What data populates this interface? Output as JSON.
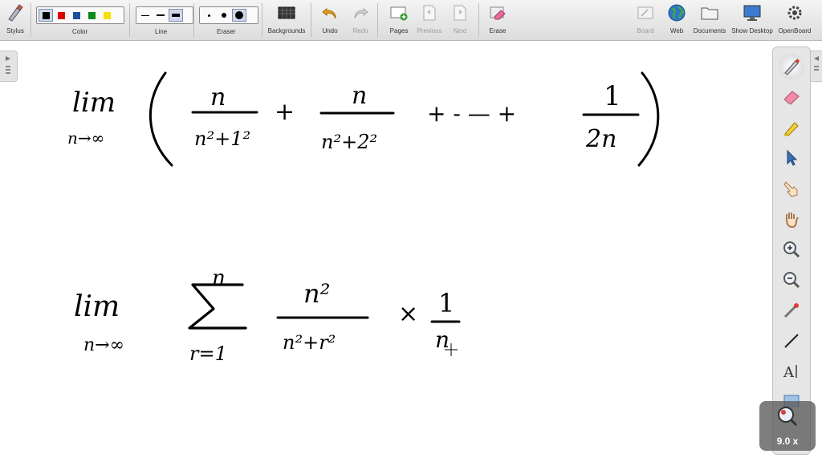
{
  "toolbar": {
    "stylus": "Stylus",
    "color": "Color",
    "line": "Line",
    "eraser": "Eraser",
    "backgrounds": "Backgrounds",
    "undo": "Undo",
    "redo": "Redo",
    "pages": "Pages",
    "previous": "Previous",
    "next": "Next",
    "erase": "Erase",
    "board": "Board",
    "web": "Web",
    "documents": "Documents",
    "show_desktop": "Show Desktop",
    "openboard": "OpenBoard"
  },
  "colors": {
    "swatches": [
      "#000000",
      "#e00000",
      "#1f4e9c",
      "#0a8a1a",
      "#f5e10a"
    ],
    "ink": "#000000",
    "toolbar_bg": "#e4e4e4"
  },
  "tools": [
    "pen-icon",
    "eraser-icon",
    "marker-icon",
    "selector-icon",
    "hand-pointer-icon",
    "hand-pan-icon",
    "zoom-in-icon",
    "zoom-out-icon",
    "laser-pointer-icon",
    "line-icon",
    "text-icon",
    "capture-icon"
  ],
  "zoom": {
    "value": "9.0 x"
  },
  "board": {
    "line1": {
      "lim": "lim",
      "sub": "n→∞",
      "f1_num": "n",
      "f1_den": "n²+1²",
      "f2_num": "n",
      "f2_den": "n²+2²",
      "dots": "+ - — +",
      "f3_num": "1",
      "f3_den": "2n"
    },
    "line2": {
      "lim": "lim",
      "sub": "n→∞",
      "sigma": "∑",
      "sigma_top": "n",
      "sigma_bot": "r=1",
      "f_num": "n²",
      "f_den": "n²+r²",
      "times": "×",
      "g_num": "1",
      "g_den": "n"
    }
  }
}
